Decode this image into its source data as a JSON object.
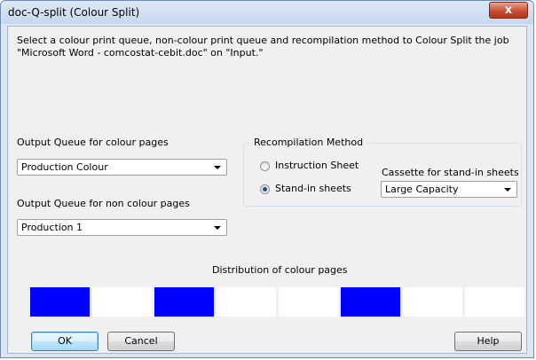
{
  "window": {
    "title": "doc-Q-split (Colour Split)",
    "close_glyph": "x",
    "close_icon": "close-icon"
  },
  "description": "Select a colour print queue, non-colour print queue and recompilation method to Colour Split the job \"Microsoft Word - comcostat-cebit.doc\" on \"Input.\"",
  "colour_queue": {
    "label": "Output Queue for colour pages",
    "value": "Production Colour"
  },
  "noncolour_queue": {
    "label": "Output Queue for non colour pages",
    "value": "Production 1"
  },
  "recompilation": {
    "group_title": "Recompilation Method",
    "options": [
      {
        "label": "Instruction Sheet",
        "checked": false
      },
      {
        "label": "Stand-in sheets",
        "checked": true
      }
    ],
    "cassette_label": "Cassette for stand-in sheets",
    "cassette_value": "Large Capacity"
  },
  "distribution": {
    "label": "Distribution of colour pages",
    "pages": [
      true,
      false,
      true,
      false,
      false,
      true,
      false,
      false
    ],
    "colour_page_color": "#0000ff",
    "non_colour_page_color": "#ffffff"
  },
  "buttons": {
    "ok": "OK",
    "cancel": "Cancel",
    "help": "Help"
  }
}
